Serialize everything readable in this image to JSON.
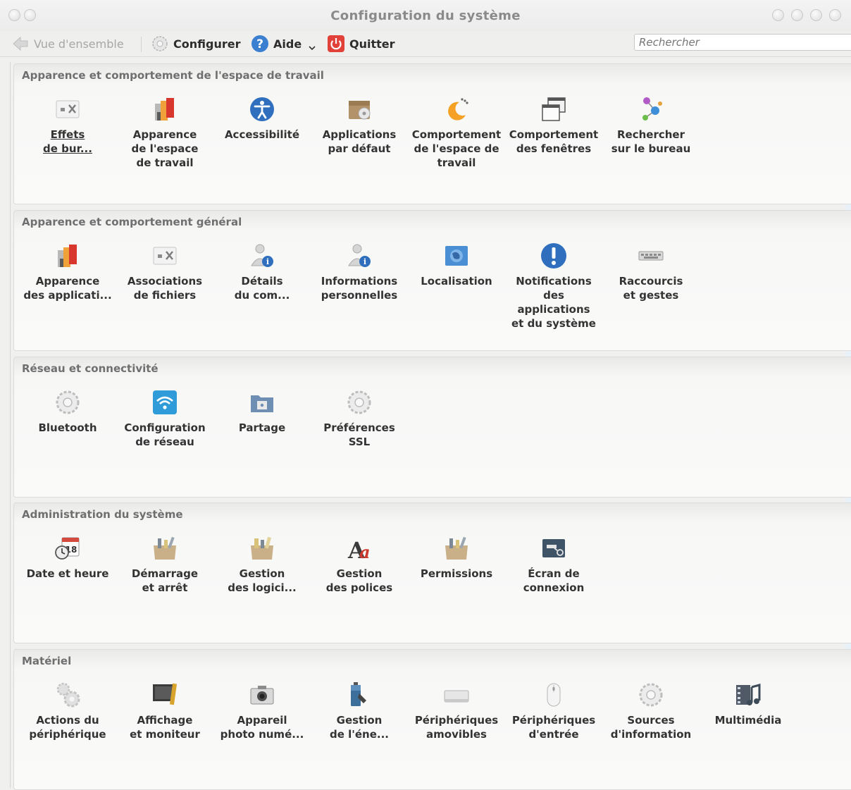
{
  "window": {
    "title": "Configuration du système"
  },
  "toolbar": {
    "overview": "Vue d'ensemble",
    "configure": "Configurer",
    "help": "Aide",
    "quit": "Quitter"
  },
  "search": {
    "placeholder": "Rechercher"
  },
  "colors": {
    "help_blue": "#3b7fd0",
    "quit_red": "#e2413a"
  },
  "sections": [
    {
      "title": "Apparence et comportement de l'espace de travail",
      "modules": [
        {
          "label": "Effets\nde bur...",
          "icon": "desktop-effects-icon"
        },
        {
          "label": "Apparence\nde l'espace\nde travail",
          "icon": "workspace-theme-icon"
        },
        {
          "label": "Accessibilité",
          "icon": "accessibility-icon"
        },
        {
          "label": "Applications\npar défaut",
          "icon": "default-applications-icon"
        },
        {
          "label": "Comportement\nde l'espace de\ntravail",
          "icon": "workspace-behavior-icon"
        },
        {
          "label": "Comportement\ndes fenêtres",
          "icon": "window-behavior-icon"
        },
        {
          "label": "Rechercher\nsur le bureau",
          "icon": "desktop-search-icon"
        }
      ]
    },
    {
      "title": "Apparence et comportement général",
      "modules": [
        {
          "label": "Apparence\ndes applicati...",
          "icon": "application-appearance-icon"
        },
        {
          "label": "Associations\nde fichiers",
          "icon": "file-associations-icon"
        },
        {
          "label": "Détails\ndu com...",
          "icon": "account-details-icon"
        },
        {
          "label": "Informations\npersonnelles",
          "icon": "personal-info-icon"
        },
        {
          "label": "Localisation",
          "icon": "locale-icon"
        },
        {
          "label": "Notifications\ndes\napplications\net du système",
          "icon": "notifications-icon"
        },
        {
          "label": "Raccourcis\net gestes",
          "icon": "shortcuts-icon"
        }
      ]
    },
    {
      "title": "Réseau et connectivité",
      "modules": [
        {
          "label": "Bluetooth",
          "icon": "bluetooth-gear-icon"
        },
        {
          "label": "Configuration\nde réseau",
          "icon": "network-wifi-icon"
        },
        {
          "label": "Partage",
          "icon": "sharing-icon"
        },
        {
          "label": "Préférences\nSSL",
          "icon": "ssl-gear-icon"
        }
      ]
    },
    {
      "title": "Administration du système",
      "modules": [
        {
          "label": "Date et heure",
          "icon": "date-time-icon"
        },
        {
          "label": "Démarrage\net arrêt",
          "icon": "startup-shutdown-icon"
        },
        {
          "label": "Gestion\ndes logici...",
          "icon": "software-management-icon"
        },
        {
          "label": "Gestion\ndes polices",
          "icon": "font-management-icon"
        },
        {
          "label": "Permissions",
          "icon": "permissions-icon"
        },
        {
          "label": "Écran de\nconnexion",
          "icon": "login-screen-icon"
        }
      ]
    },
    {
      "title": "Matériel",
      "modules": [
        {
          "label": "Actions du\npériphérique",
          "icon": "device-actions-icon"
        },
        {
          "label": "Affichage\net moniteur",
          "icon": "display-monitor-icon"
        },
        {
          "label": "Appareil\nphoto numé...",
          "icon": "camera-icon"
        },
        {
          "label": "Gestion\nde l'éne...",
          "icon": "power-management-icon"
        },
        {
          "label": "Périphériques\namovibles",
          "icon": "removable-devices-icon"
        },
        {
          "label": "Périphériques\nd'entrée",
          "icon": "input-devices-icon"
        },
        {
          "label": "Sources\nd'information",
          "icon": "information-sources-icon"
        },
        {
          "label": "Multimédia",
          "icon": "multimedia-icon"
        }
      ]
    }
  ]
}
